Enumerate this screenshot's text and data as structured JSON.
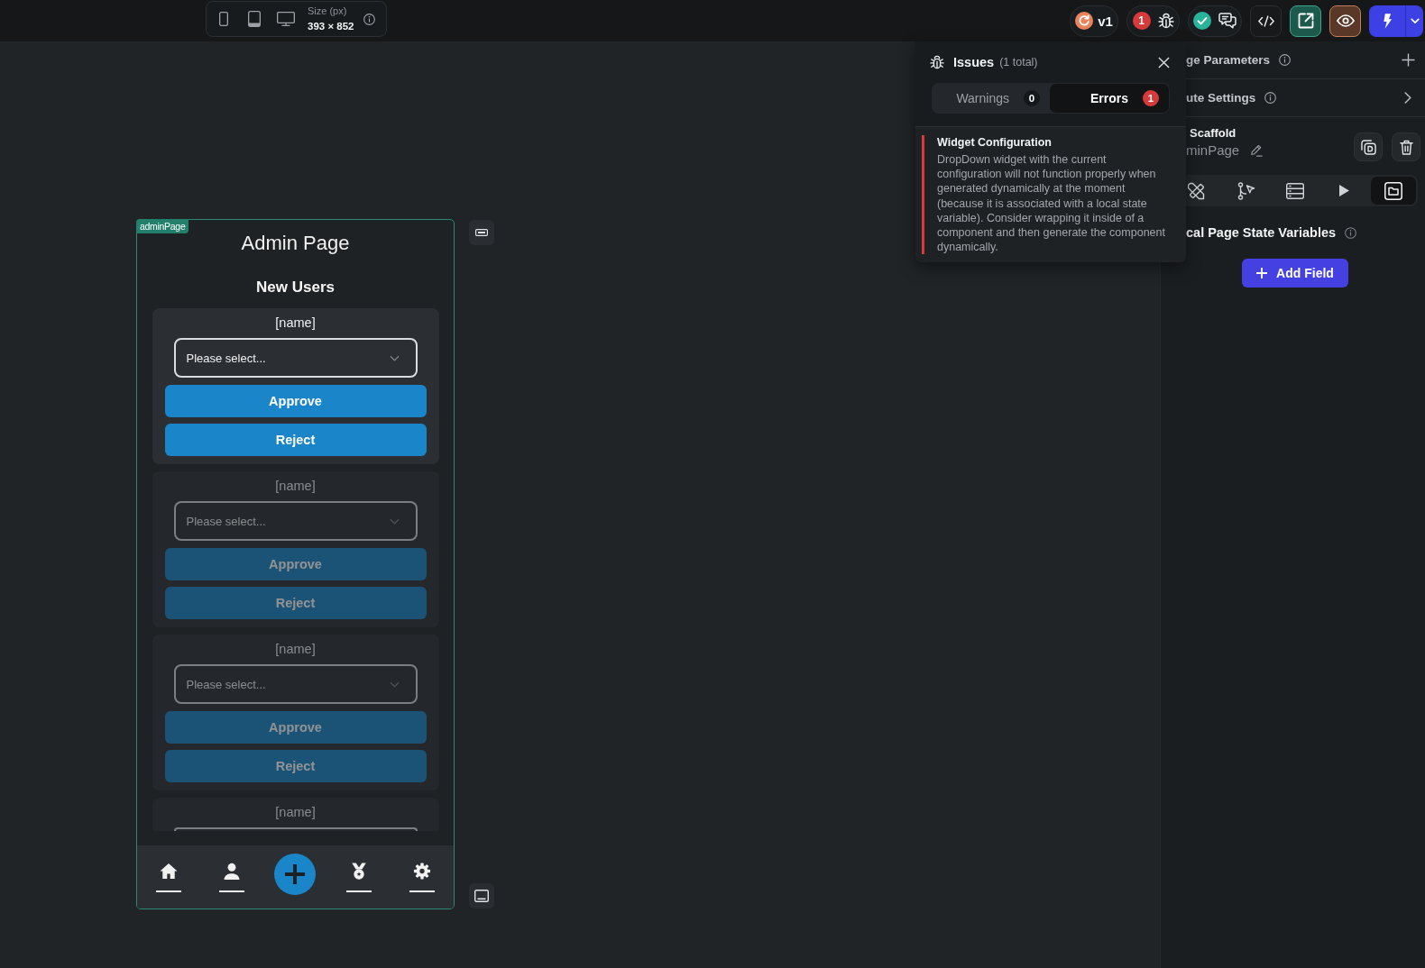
{
  "toolbar": {
    "size_label": "Size (px)",
    "size_value": "393 × 852"
  },
  "top_actions": {
    "version": "v1",
    "error_count": "1"
  },
  "phone": {
    "tag": "adminPage",
    "title": "Admin Page",
    "heading": "New Users",
    "users": [
      {
        "kind": "full",
        "faded": false,
        "name": "[name]",
        "placeholder": "Please select...",
        "approve": "Approve",
        "reject": "Reject"
      },
      {
        "kind": "full",
        "faded": true,
        "name": "[name]",
        "placeholder": "Please select...",
        "approve": "Approve",
        "reject": "Reject"
      },
      {
        "kind": "full",
        "faded": true,
        "name": "[name]",
        "placeholder": "Please select...",
        "approve": "Approve",
        "reject": "Reject"
      },
      {
        "kind": "clipped",
        "faded": true,
        "name": "[name]"
      }
    ]
  },
  "issues": {
    "title": "Issues",
    "total": "(1 total)",
    "tabs": [
      {
        "kind": "warning",
        "label": "Warnings",
        "count": "0",
        "selected": false
      },
      {
        "kind": "error",
        "label": "Errors",
        "count": "1",
        "selected": true
      }
    ],
    "items": [
      {
        "kind": "error",
        "title": "Widget Configuration",
        "message": "DropDown widget with the current configuration will not function properly when generated dynamically at the moment (because it is associated with a local state variable). Consider wrapping it inside of a component and then generate the component dynamically."
      }
    ]
  },
  "properties": {
    "rows": [
      {
        "kind": "add",
        "label": "ge Parameters"
      },
      {
        "kind": "expand",
        "label": "ute Settings"
      }
    ],
    "widget": {
      "type": "Scaffold",
      "name": "minPage"
    },
    "tabs": [
      {
        "selected": false
      },
      {
        "selected": false
      },
      {
        "selected": false
      },
      {
        "selected": false
      },
      {
        "selected": true
      }
    ],
    "section": "cal Page State Variables",
    "add_button": "Add Field"
  }
}
